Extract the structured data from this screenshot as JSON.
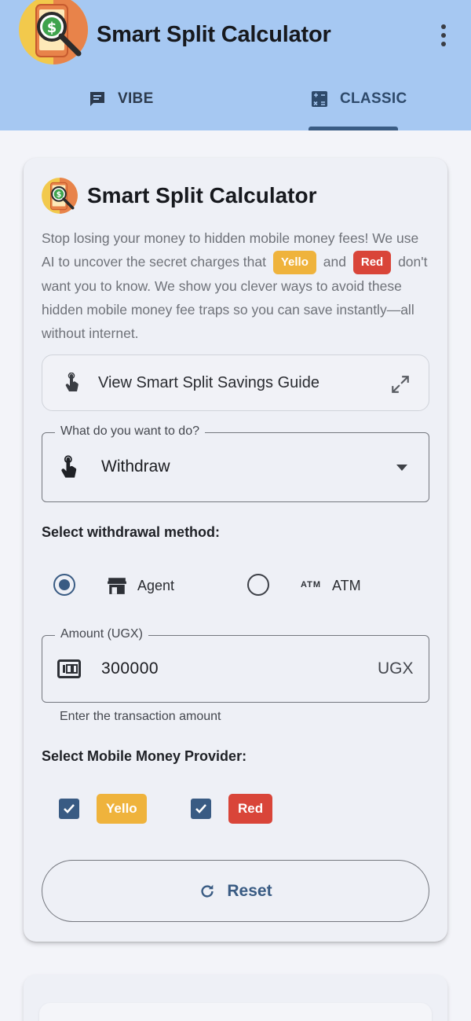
{
  "header": {
    "title": "Smart Split Calculator",
    "logo_icon": "phone-money-magnifier-icon",
    "menu_icon": "more-vert-icon"
  },
  "tabs": [
    {
      "label": "VIBE",
      "icon": "chat-icon",
      "selected": false
    },
    {
      "label": "CLASSIC",
      "icon": "calculator-icon",
      "selected": true
    }
  ],
  "card": {
    "title": "Smart Split Calculator",
    "description_part1": "Stop losing your money to hidden mobile money fees! We use AI to uncover the secret charges that",
    "chip_yellow": "Yello",
    "description_and": "and",
    "chip_red": "Red",
    "description_part2": "don't want you to know. We show you clever ways to avoid these hidden mobile money fee traps so you can save instantly—all without internet.",
    "guide_button": "View Smart Split Savings Guide",
    "action_field": {
      "label": "What do you want to do?",
      "value": "Withdraw"
    },
    "method_label": "Select withdrawal method:",
    "methods": [
      {
        "label": "Agent",
        "icon": "store-icon",
        "selected": true
      },
      {
        "label": "ATM",
        "icon": "atm-icon",
        "icon_text": "ATM",
        "selected": false
      }
    ],
    "amount_field": {
      "label": "Amount (UGX)",
      "value": "300000",
      "suffix": "UGX",
      "helper": "Enter the transaction amount"
    },
    "provider_label": "Select Mobile Money Provider:",
    "providers": [
      {
        "label": "Yello",
        "checked": true,
        "color": "#efb33c"
      },
      {
        "label": "Red",
        "checked": true,
        "color": "#d94539"
      }
    ],
    "reset_button": "Reset"
  },
  "colors": {
    "appbar": "#a6c8f2",
    "primary": "#395b83",
    "background": "#f3f4f9"
  }
}
